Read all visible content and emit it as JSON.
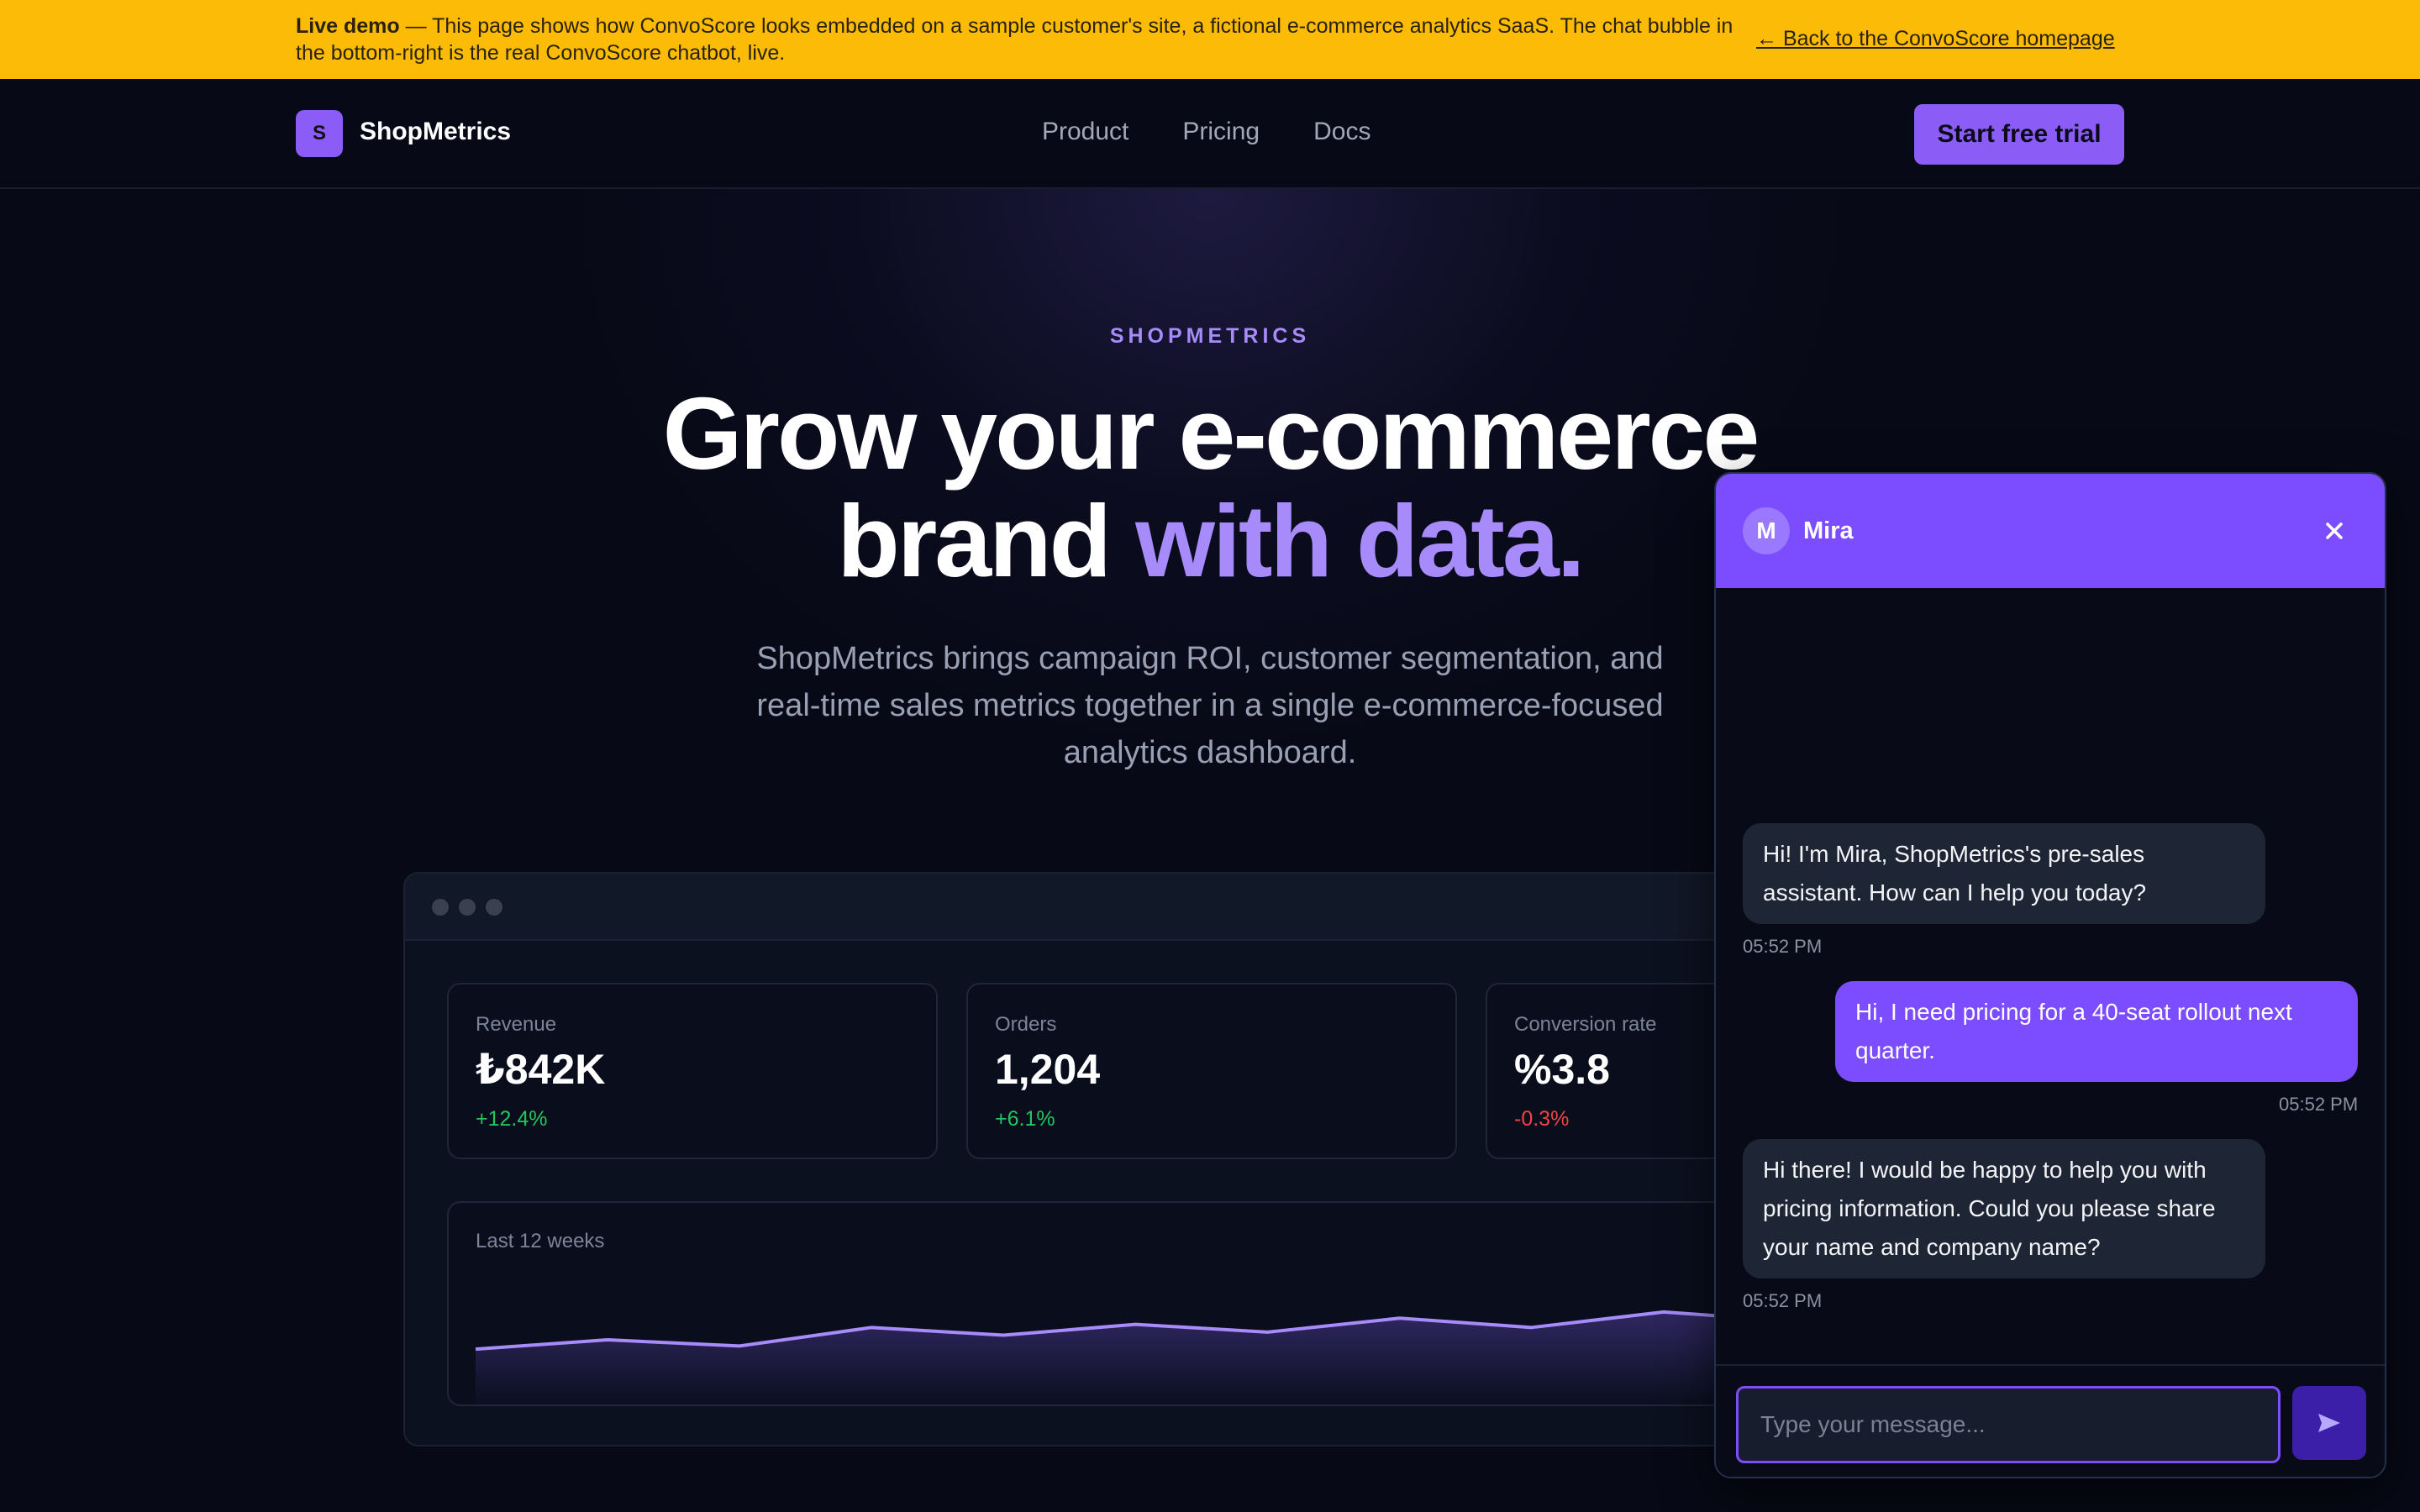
{
  "banner": {
    "bold": "Live demo",
    "text": " — This page shows how ConvoScore looks embedded on a sample customer's site, a fictional e-commerce analytics SaaS. The chat bubble in the bottom-right is the real ConvoScore chatbot, live.",
    "link": "← Back to the ConvoScore homepage"
  },
  "nav": {
    "logo_letter": "S",
    "brand": "ShopMetrics",
    "links": [
      "Product",
      "Pricing",
      "Docs"
    ],
    "cta": "Start free trial"
  },
  "hero": {
    "eyebrow": "SHOPMETRICS",
    "headline_1": "Grow your e-commerce",
    "headline_2_plain": "brand ",
    "headline_2_accent": "with data.",
    "subhead": "ShopMetrics brings campaign ROI, customer segmentation, and real-time sales metrics together in a single e-commerce-focused analytics dashboard."
  },
  "dashboard": {
    "cards": [
      {
        "label": "Revenue",
        "value": "₺842K",
        "delta": "+12.4%",
        "trend": "up"
      },
      {
        "label": "Orders",
        "value": "1,204",
        "delta": "+6.1%",
        "trend": "up"
      },
      {
        "label": "Conversion rate",
        "value": "%3.8",
        "delta": "-0.3%",
        "trend": "down"
      }
    ],
    "chart_label": "Last 12 weeks"
  },
  "chart_data": {
    "type": "area",
    "title": "Last 12 weeks",
    "x": [
      1,
      2,
      3,
      4,
      5,
      6,
      7,
      8,
      9,
      10,
      11,
      12
    ],
    "values": [
      38,
      44,
      40,
      52,
      47,
      54,
      49,
      58,
      52,
      62,
      56,
      66
    ],
    "ylim": [
      0,
      100
    ],
    "grid": false
  },
  "colors": {
    "accent": "#8b5cf6",
    "accent_light": "#a78bfa",
    "positive": "#22c55e",
    "negative": "#ef4444",
    "banner": "#fbbb06"
  },
  "chat": {
    "avatar_letter": "M",
    "agent_name": "Mira",
    "close_icon": "close-icon",
    "messages": [
      {
        "from": "bot",
        "text": "Hi! I'm Mira, ShopMetrics's pre-sales assistant. How can I help you today?",
        "time": "05:52 PM"
      },
      {
        "from": "user",
        "text": "Hi, I need pricing for a 40-seat rollout next quarter.",
        "time": "05:52 PM"
      },
      {
        "from": "bot",
        "text": "Hi there! I would be happy to help you with pricing information. Could you please share your name and company name?",
        "time": "05:52 PM"
      }
    ],
    "input_placeholder": "Type your message...",
    "send_icon": "send-icon"
  }
}
